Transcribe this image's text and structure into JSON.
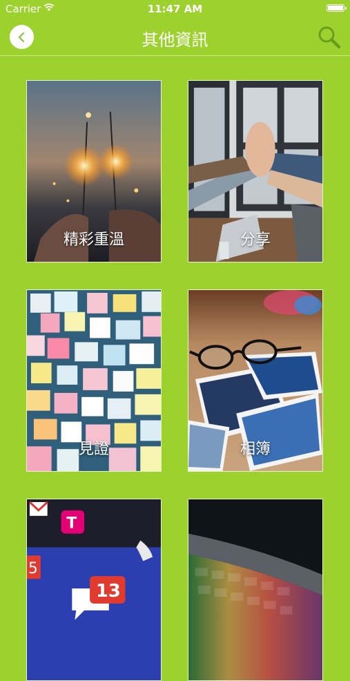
{
  "status_bar": {
    "carrier": "Carrier",
    "time": "11:47 AM"
  },
  "nav": {
    "title": "其他資訊"
  },
  "cards": [
    {
      "label": "精彩重溫",
      "image": "sparklers-photo"
    },
    {
      "label": "分享",
      "image": "high-five-photo"
    },
    {
      "label": "見證",
      "image": "sticky-notes-photo"
    },
    {
      "label": "相簿",
      "image": "glasses-photos-photo"
    },
    {
      "label": "",
      "image": "phone-notification-photo"
    },
    {
      "label": "",
      "image": "keyboard-photo"
    }
  ]
}
